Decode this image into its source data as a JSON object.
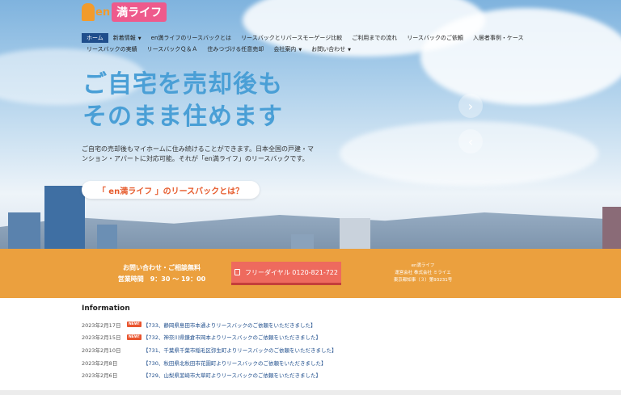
{
  "logo": {
    "en": "en",
    "name": "満ライフ"
  },
  "nav": {
    "row1": [
      {
        "label": "ホーム",
        "active": true,
        "dropdown": false
      },
      {
        "label": "新着情報",
        "active": false,
        "dropdown": true
      },
      {
        "label": "en満ライフのリースバックとは",
        "active": false,
        "dropdown": false
      },
      {
        "label": "リースバックとリバースモーゲージ比較",
        "active": false,
        "dropdown": false
      },
      {
        "label": "ご利用までの流れ",
        "active": false,
        "dropdown": false
      },
      {
        "label": "リースバックのご依頼",
        "active": false,
        "dropdown": false
      },
      {
        "label": "入居者事例・ケース",
        "active": false,
        "dropdown": false
      }
    ],
    "row2": [
      {
        "label": "リースバックの実績",
        "active": false,
        "dropdown": false
      },
      {
        "label": "リースバックＱ＆Ａ",
        "active": false,
        "dropdown": false
      },
      {
        "label": "住みつづける任意売却",
        "active": false,
        "dropdown": false
      },
      {
        "label": "会社案内",
        "active": false,
        "dropdown": true
      },
      {
        "label": "お問い合わせ",
        "active": false,
        "dropdown": true
      }
    ]
  },
  "hero": {
    "headline_line1": "ご自宅を売却後も",
    "headline_line2": "そのまま住めます",
    "subtext_line1": "ご自宅の売却後もマイホームに住み続けることができます。日本全国の戸建・マ",
    "subtext_line2": "ンション・アパートに対応可能。それが「en満ライフ」のリースバックです。",
    "cta": "「 en満ライフ 」のリースバックとは？",
    "next_arrow": "›",
    "prev_arrow": "‹"
  },
  "contact_bar": {
    "line1": "お問い合わせ・ご相談無料",
    "line2": "営業時間　9：30 〜 19：00",
    "button": "フリーダイヤル 0120-821-722",
    "company_name": "en満ライフ",
    "company_operator": "運営会社 株式会社 ミライエ",
    "company_license": "東京都知事（３）第93231号"
  },
  "info": {
    "title": "Information",
    "items": [
      {
        "date": "2023年2月17日",
        "badge": "NEW!",
        "text": "【733、静岡県島田市本通よりリースバックのご依頼をいただきました】"
      },
      {
        "date": "2023年2月15日",
        "badge": "NEW!",
        "text": "【732、神奈川県鎌倉市岡本よりリースバックのご依頼をいただきました】"
      },
      {
        "date": "2023年2月10日",
        "badge": "",
        "text": "【731、千葉県千葉市稲毛区弥生町よりリースバックのご依頼をいただきました】"
      },
      {
        "date": "2023年2月8日",
        "badge": "",
        "text": "【730、秋田県北秋田市花園町よりリースバックのご依頼をいただきました】"
      },
      {
        "date": "2023年2月6日",
        "badge": "",
        "text": "【729、山梨県韮崎市大草町よりリースバックのご依頼をいただきました】"
      }
    ]
  },
  "colors": {
    "headline": "#4a9fd6",
    "accent_orange": "#eba03e",
    "button_red": "#ee6a5e",
    "nav_active": "#1f4e8c",
    "badge": "#e9552f"
  }
}
